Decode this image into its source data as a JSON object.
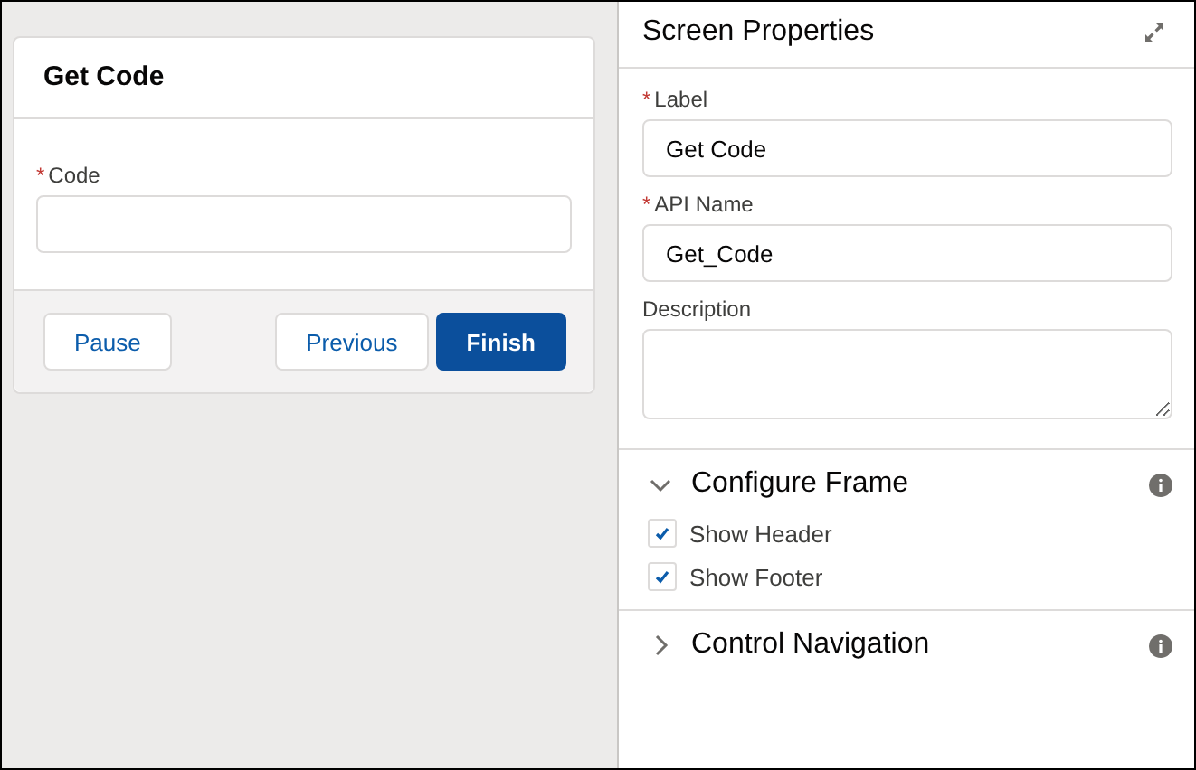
{
  "screen_preview": {
    "title": "Get Code",
    "fields": [
      {
        "label": "Code",
        "required_mark": "*"
      }
    ],
    "footer": {
      "left_buttons": [
        {
          "label": "Pause"
        }
      ],
      "right_buttons": [
        {
          "label": "Previous",
          "kind": "neutral"
        },
        {
          "label": "Finish",
          "kind": "brand"
        }
      ]
    }
  },
  "properties": {
    "title": "Screen Properties",
    "fields": [
      {
        "label": "Label",
        "required_mark": "*",
        "value": "Get Code",
        "kind": "input"
      },
      {
        "label": "API Name",
        "required_mark": "*",
        "value": "Get_Code",
        "kind": "input"
      },
      {
        "label": "Description",
        "kind": "textarea"
      }
    ],
    "sections": [
      {
        "title": "Configure Frame",
        "expanded": true,
        "options": [
          {
            "label": "Show Header",
            "checked": true
          },
          {
            "label": "Show Footer",
            "checked": true
          }
        ]
      },
      {
        "title": "Control Navigation",
        "expanded": false
      }
    ]
  }
}
